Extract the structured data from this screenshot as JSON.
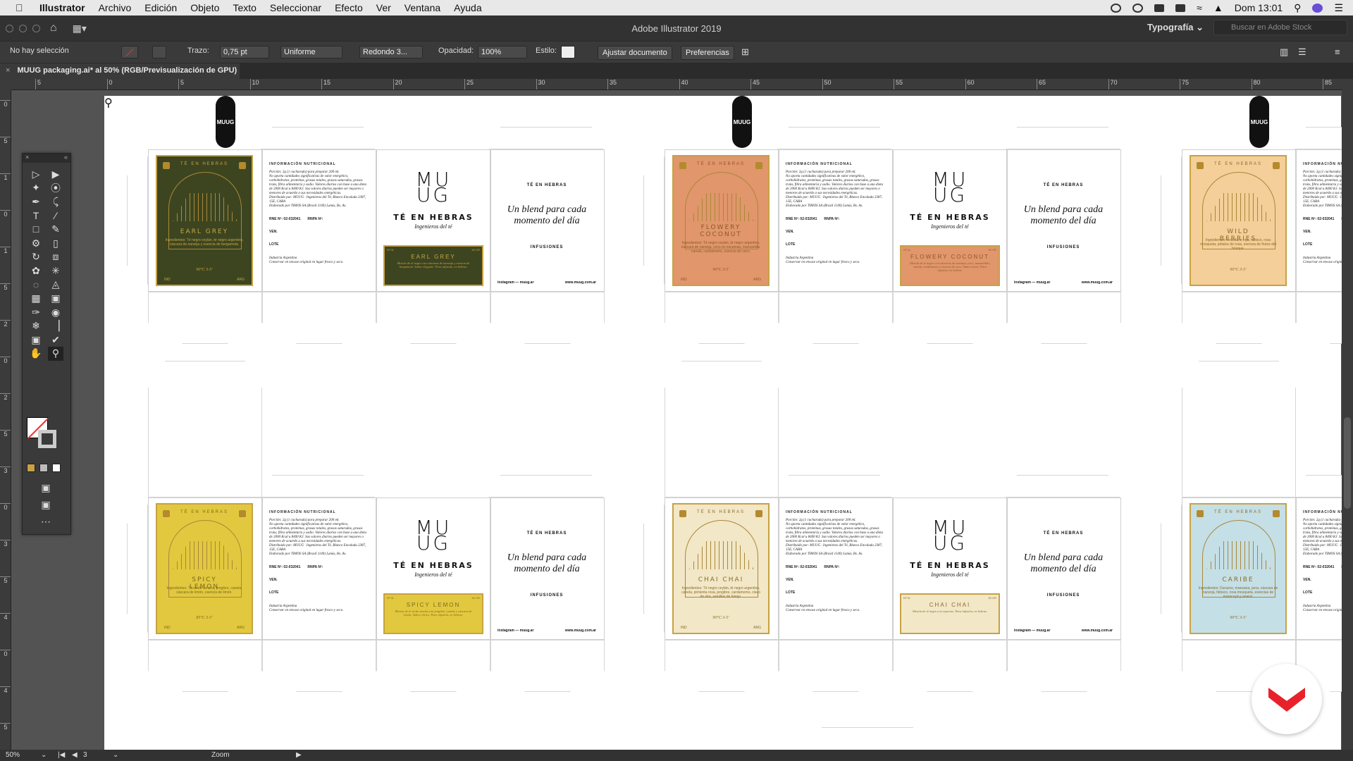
{
  "menubar": {
    "app": "Illustrator",
    "items": [
      "Archivo",
      "Edición",
      "Objeto",
      "Texto",
      "Seleccionar",
      "Efecto",
      "Ver",
      "Ventana",
      "Ayuda"
    ],
    "clock": "Dom 13:01"
  },
  "appbar": {
    "title": "Adobe Illustrator 2019",
    "workspace": "Typografía",
    "stock_placeholder": "Buscar en Adobe Stock"
  },
  "control": {
    "selection": "No hay selección",
    "stroke_label": "Trazo:",
    "stroke_value": "0,75 pt",
    "profile": "Uniforme",
    "brush": "Redondo 3...",
    "opacity_label": "Opacidad:",
    "opacity_value": "100%",
    "style_label": "Estilo:",
    "btn_doc": "Ajustar documento",
    "btn_prefs": "Preferencias"
  },
  "doctab": {
    "close": "×",
    "title": "MUUG packaging.ai* al 50% (RGB/Previsualización de GPU)"
  },
  "hruler": [
    "5",
    "0",
    "5",
    "10",
    "15",
    "20",
    "25",
    "30",
    "35",
    "40",
    "45",
    "50",
    "55",
    "60",
    "65",
    "70",
    "75",
    "80",
    "85"
  ],
  "vruler": [
    "0",
    "5",
    "1",
    "0",
    "1",
    "5",
    "2",
    "0",
    "2",
    "5",
    "3",
    "0",
    "3",
    "5",
    "4",
    "0",
    "4",
    "5"
  ],
  "status": {
    "zoom": "50%",
    "page": "3",
    "tool": "Zoom"
  },
  "pill": "MUUG",
  "nutri": {
    "title": "INFORMACIÓN NUTRICIONAL",
    "serving": "Porción: 2g (1 cucharada) para preparar 200 ml.",
    "body": "No aporta cantidades significativas de valor energético, carbohidratos, proteínas, grasas totales, grasas saturadas, grasas trans, fibra alimentaria y sodio. Valores diarios con base a una dieta de 2000 Kcal u 8400 KJ. Sus valores diarios pueden ser mayores o menores de acuerdo a sus necesidades energéticas.",
    "dist": "Distribuido por: MUUG · Ingenieros del Té, Blanco Encalada 2387, 15E, CABA",
    "elab": "Elaborado por TIMOS SA (Brasil 1140) Lanús, Bs. As.",
    "rne": "RNE Nº: 02-032041",
    "rnpa": "RNPA Nº:",
    "ven": "VEN.",
    "lote": "LOTE",
    "ind": "Industria Argentina",
    "cons": "Conservar en envase original en lugar fresco y seco."
  },
  "logo": {
    "mark1": "MU",
    "mark2": "UG",
    "sub": "TÉ EN HEBRAS",
    "sub2": "Ingenieros del té"
  },
  "side": {
    "ten": "TÉ EN HEBRAS",
    "blend": "Un blend para cada momento del día",
    "inf": "INFUSIONES",
    "ig": "instagram — muug.ar",
    "web": "www.muug.com.ar"
  },
  "labels": [
    {
      "arc": "TÉ EN HEBRAS",
      "name": "EARL GREY",
      "ingr": "Ingredientes: Té negro ceylán, té negro argentino, cáscara de naranja y esencia de bergamota.",
      "temp": "90°C  3-5'",
      "ind": "IND",
      "arg": "ARG",
      "bg": "#3d4520",
      "fg": "#c9a544",
      "sticker": "EARL GREY",
      "desc": "Mezcla de té negro con cáscaras de naranja y esencia de bergamota. Sabor elegante. Para infusión, en hebras."
    },
    {
      "arc": "TÉ EN HEBRAS",
      "name": "FLOWERY COCONUT",
      "ingr": "Ingredientes: Té negro ceylán, té negro argentino, cáscara de naranja, coco en escamas, manzanilla, canela, cardamomo, esencia de coco.",
      "temp": "90°C  3-5'",
      "ind": "IND",
      "arg": "ARG",
      "bg": "#e1966b",
      "fg": "#8a5a2a",
      "sticker": "FLOWERY COCONUT",
      "desc": "Mezcla de té negro con cáscaras de naranja, coco, manzanilla, canela, cardamomo y esencia de coco. Sabor suave. Para infusión, en hebras."
    },
    {
      "arc": "TÉ EN HEBRAS",
      "name": "WILD BERRIES",
      "ingr": "Ingredientes: Arándano rojo, hibisco, rosa mosqueta, pétalos de rosa, esencia de frutos del bosque.",
      "temp": "90°C  3-5'",
      "ind": "",
      "arg": "",
      "bg": "#f4cf99",
      "fg": "#8a6b2a",
      "sticker": "",
      "desc": ""
    },
    {
      "arc": "TÉ EN HEBRAS",
      "name": "SPICY LEMON",
      "ingr": "Ingredientes: Té verde sencha, jengibre, canela, cáscara de limón, esencia de limón.",
      "temp": "85°C  3-5'",
      "ind": "IND",
      "arg": "ARG",
      "bg": "#e2c83e",
      "fg": "#7a6a20",
      "sticker": "SPICY LEMON",
      "desc": "Mezcla de té verde sencha con jengibre, canela y cáscara de limón. Sabor cítrico. Para infusión, en hebras."
    },
    {
      "arc": "TÉ EN HEBRAS",
      "name": "CHAI CHAI",
      "ingr": "Ingredientes: Té negro ceylán, té negro argentino, canela, pimienta rosa, jengibre, cardamomo, clavo de olor, semillas de hinojo.",
      "temp": "90°C  3-5'",
      "ind": "IND",
      "arg": "ARG",
      "bg": "#f2e7c7",
      "fg": "#8a6b2a",
      "sticker": "CHAI CHAI",
      "desc": "Mezcla de té negro con especias. Para infusión, en hebras."
    },
    {
      "arc": "TÉ EN HEBRAS",
      "name": "CARIBE",
      "ingr": "Ingredientes: Durazno, manzana, pera, cáscara de naranja, hibisco, rosa mosqueta, esencias de maracuyá y ananá.",
      "temp": "90°C  3-5'",
      "ind": "",
      "arg": "",
      "bg": "#c5dfe6",
      "fg": "#8a6b2a",
      "sticker": "",
      "desc": ""
    }
  ],
  "sticker_no": "Nº 01",
  "sticker_gr": "50 GR"
}
